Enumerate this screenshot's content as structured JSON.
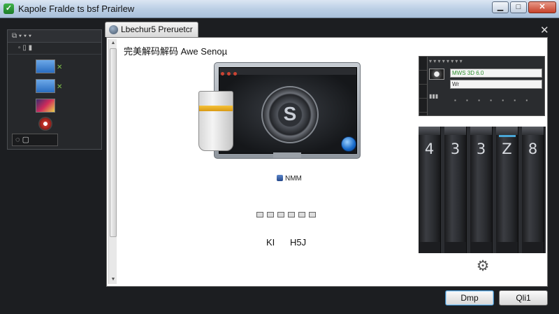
{
  "window": {
    "title": "Kapole Fralde ts bsf Prairlew",
    "minimize_glyph": "▁",
    "maximize_glyph": "□",
    "close_glyph": "✕"
  },
  "left_panel": {
    "header": "⧉ ▾ ▾ ▾",
    "row_labels": "▫  ▯ ▮",
    "last_control": "◌  ▢"
  },
  "dialog": {
    "tab_title": "Lbechur5 Preruetcr",
    "close_glyph": "✕",
    "section_title": "完美解码解码 Awe Senoµ",
    "device_label": "NMM",
    "value_a": "KI",
    "value_b": "H5J",
    "mixer": {
      "field_1": "MWS 3D 6.0",
      "field_2": "Wr",
      "knob_glyph": "S"
    },
    "faders": [
      "4",
      "3",
      "3",
      "Z",
      "8"
    ]
  },
  "buttons": {
    "ok": "Dmp",
    "quit": "Qli1"
  },
  "colors": {
    "accent_blue": "#4aa6d6",
    "panel_dark": "#26282b",
    "dialog_bg": "#ffffff"
  }
}
